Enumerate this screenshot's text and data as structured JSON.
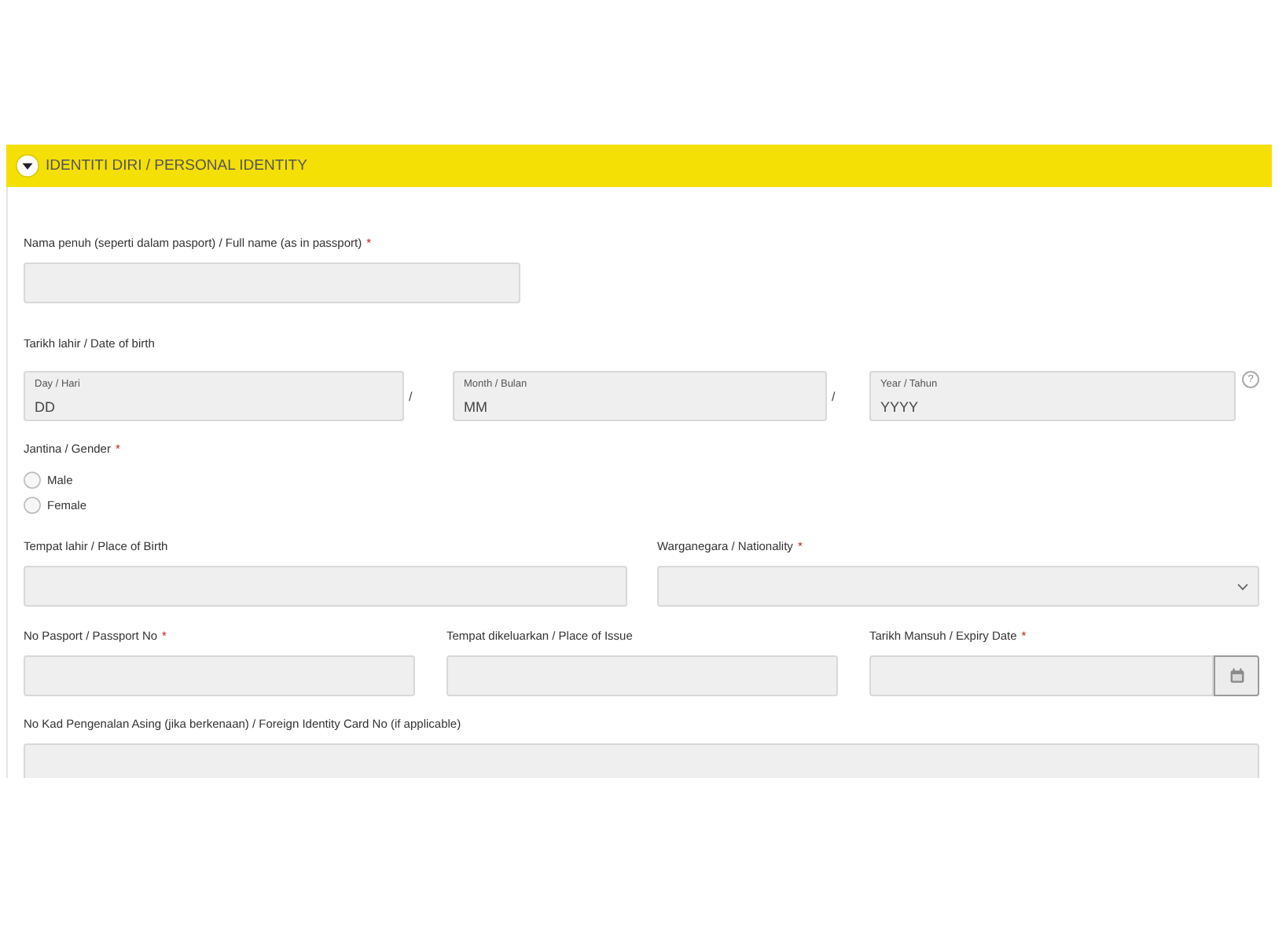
{
  "section": {
    "title": "IDENTITI DIRI / PERSONAL IDENTITY",
    "expanded": true
  },
  "full_name": {
    "label": "Nama penuh (seperti dalam pasport) / Full name (as in passport)",
    "required_mark": "*"
  },
  "date_of_birth": {
    "label": "Tarikh lahir / Date of birth",
    "parts": [
      {
        "label": "Day / Hari",
        "placeholder": "DD",
        "separator": "/"
      },
      {
        "label": "Month / Bulan",
        "placeholder": "MM",
        "separator": "/"
      },
      {
        "label": "Year / Tahun",
        "placeholder": "YYYY"
      }
    ],
    "help": "?"
  },
  "gender": {
    "label": "Jantina / Gender",
    "required_mark": "*",
    "options": [
      {
        "label": "Male",
        "selected": false
      },
      {
        "label": "Female",
        "selected": false
      }
    ]
  },
  "place_of_birth": {
    "label": "Tempat lahir / Place of Birth"
  },
  "nationality": {
    "label": "Warganegara / Nationality",
    "required_mark": "*"
  },
  "passport_no": {
    "label": "No Pasport / Passport No",
    "required_mark": "*"
  },
  "place_of_issue": {
    "label": "Tempat dikeluarkan / Place of Issue"
  },
  "expiry_date": {
    "label": "Tarikh Mansuh / Expiry Date",
    "required_mark": "*"
  },
  "foreign_id": {
    "label": "No Kad Pengenalan Asing (jika berkenaan) / Foreign Identity Card No (if applicable)"
  }
}
